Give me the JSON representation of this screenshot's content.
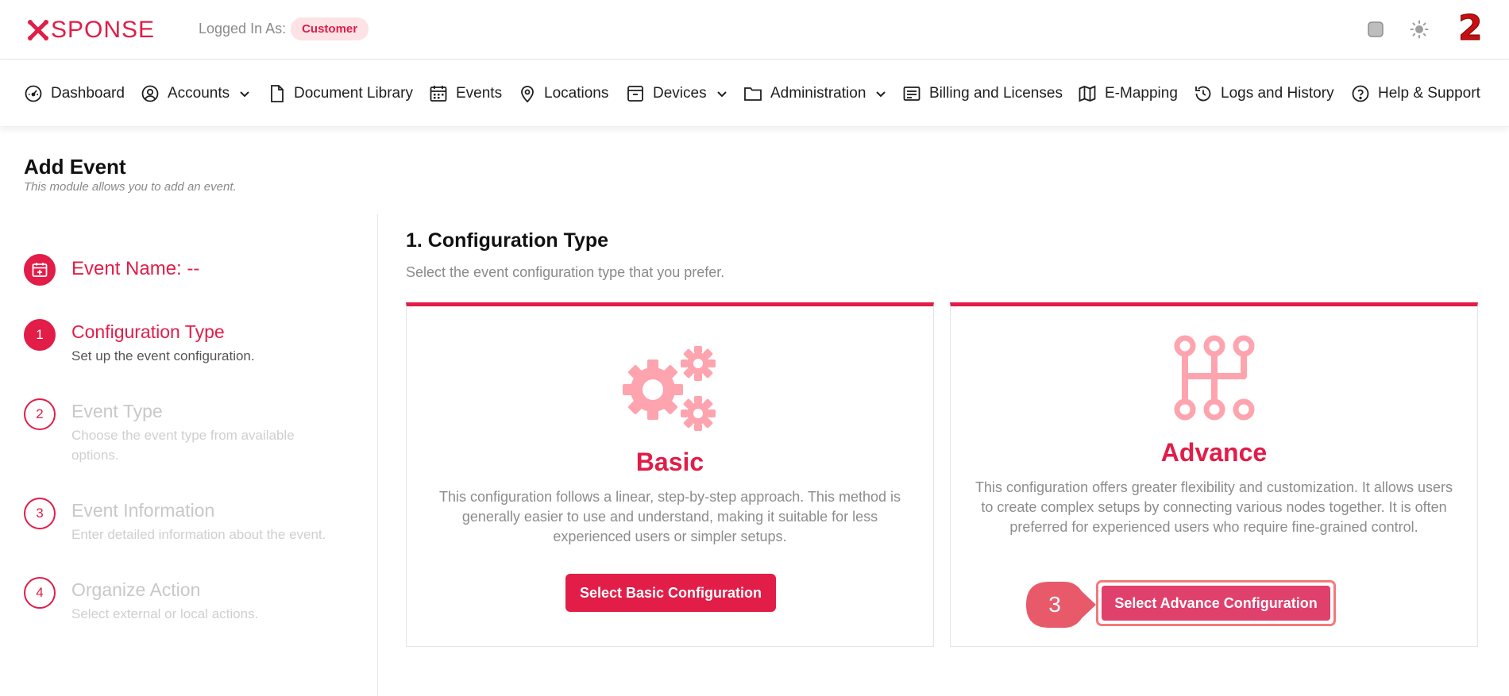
{
  "header": {
    "logo_text": "SPONSE",
    "logged_in_label": "Logged In As:",
    "role": "Customer",
    "notification_count": "2"
  },
  "nav": {
    "items": [
      {
        "label": "Dashboard",
        "icon": "gauge-icon"
      },
      {
        "label": "Accounts",
        "icon": "user-circle-icon",
        "dropdown": true
      },
      {
        "label": "Document Library",
        "icon": "document-icon"
      },
      {
        "label": "Events",
        "icon": "calendar-icon"
      },
      {
        "label": "Locations",
        "icon": "location-pin-icon"
      },
      {
        "label": "Devices",
        "icon": "device-icon",
        "dropdown": true
      },
      {
        "label": "Administration",
        "icon": "folder-icon",
        "dropdown": true
      },
      {
        "label": "Billing and Licenses",
        "icon": "receipt-icon"
      },
      {
        "label": "E-Mapping",
        "icon": "map-icon"
      },
      {
        "label": "Logs and History",
        "icon": "history-icon"
      },
      {
        "label": "Help & Support",
        "icon": "help-circle-icon"
      }
    ]
  },
  "page": {
    "title": "Add Event",
    "subtitle": "This module allows you to add an event."
  },
  "stepper": {
    "event_name": "Event Name: --",
    "steps": [
      {
        "number": "1",
        "title": "Configuration Type",
        "desc": "Set up the event configuration."
      },
      {
        "number": "2",
        "title": "Event Type",
        "desc": "Choose the event type from available options."
      },
      {
        "number": "3",
        "title": "Event Information",
        "desc": "Enter detailed information about the event."
      },
      {
        "number": "4",
        "title": "Organize Action",
        "desc": "Select external or local actions."
      }
    ]
  },
  "config": {
    "title": "1. Configuration Type",
    "subtitle": "Select the event configuration type that you prefer.",
    "basic": {
      "title": "Basic",
      "desc": "This configuration follows a linear, step-by-step approach. This method is generally easier to use and understand, making it suitable for less experienced users or simpler setups.",
      "button": "Select Basic Configuration"
    },
    "advance": {
      "title": "Advance",
      "desc": "This configuration offers greater flexibility and customization. It allows users to create complex setups by connecting various nodes together. It is often preferred for experienced users who require fine-grained control.",
      "button": "Select Advance Configuration"
    }
  },
  "annotation": {
    "step_marker": "3"
  },
  "colors": {
    "accent": "#e11d48",
    "icon_pink": "#fda4af",
    "muted": "#8a8a8a"
  }
}
